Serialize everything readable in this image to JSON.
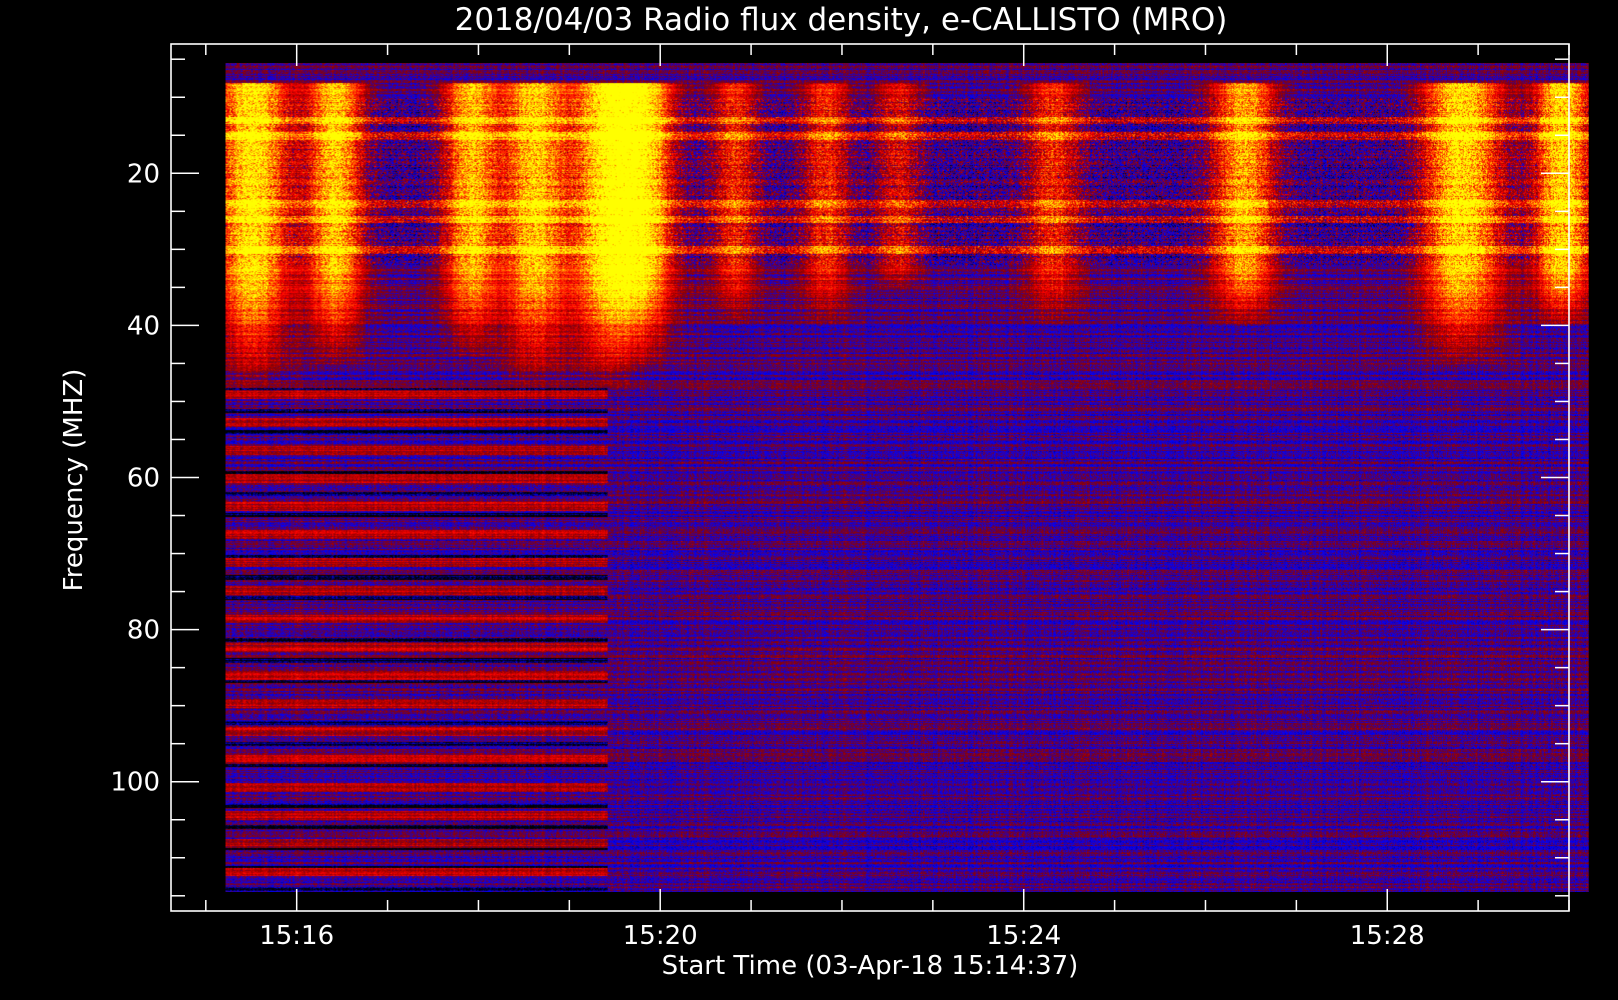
{
  "chart_data": {
    "type": "heatmap",
    "title": "2018/04/03  Radio flux density, e-CALLISTO (MRO)",
    "xlabel": "Start Time (03-Apr-18 15:14:37)",
    "ylabel": "Frequency (MHZ)",
    "x_range": [
      "15:14:37",
      "15:30:00"
    ],
    "y_range_mhz": [
      117,
      3
    ],
    "y_axis_inverted": true,
    "x_tick_labels": [
      "15:16",
      "15:20",
      "15:24",
      "15:28"
    ],
    "x_tick_values_min": [
      1.383,
      5.383,
      9.383,
      13.383
    ],
    "y_tick_labels": [
      "20",
      "40",
      "60",
      "80",
      "100"
    ],
    "y_tick_values": [
      20,
      40,
      60,
      80,
      100
    ],
    "data_time_range_min": [
      0.6,
      15.6
    ],
    "data_freq_range_mhz": [
      5.5,
      114.5
    ],
    "colormap": [
      "#000000",
      "#0000ff",
      "#8b0000",
      "#ff0000",
      "#ff8000",
      "#ffff00"
    ],
    "background_level": 0.3,
    "intensity": {
      "description": "vertical broadband bursts at start times in minutes (relative to 15:14:37), strong emission between 8 and 45 MHz; quiet band-structured region below 48 MHz before 15:18:40",
      "bursts_min": [
        {
          "t": 0.9,
          "width": 0.45,
          "strength": 0.95,
          "f_low": 8,
          "f_high": 48
        },
        {
          "t": 1.8,
          "width": 0.35,
          "strength": 0.85,
          "f_low": 8,
          "f_high": 45
        },
        {
          "t": 3.3,
          "width": 0.35,
          "strength": 0.8,
          "f_low": 8,
          "f_high": 44
        },
        {
          "t": 4.0,
          "width": 0.4,
          "strength": 0.85,
          "f_low": 8,
          "f_high": 48
        },
        {
          "t": 4.8,
          "width": 0.45,
          "strength": 0.95,
          "f_low": 8,
          "f_high": 48
        },
        {
          "t": 5.2,
          "width": 0.4,
          "strength": 0.8,
          "f_low": 8,
          "f_high": 45
        },
        {
          "t": 6.2,
          "width": 0.3,
          "strength": 0.45,
          "f_low": 8,
          "f_high": 40
        },
        {
          "t": 7.2,
          "width": 0.3,
          "strength": 0.45,
          "f_low": 8,
          "f_high": 40
        },
        {
          "t": 8.0,
          "width": 0.3,
          "strength": 0.35,
          "f_low": 8,
          "f_high": 35
        },
        {
          "t": 9.7,
          "width": 0.35,
          "strength": 0.45,
          "f_low": 8,
          "f_high": 40
        },
        {
          "t": 11.8,
          "width": 0.4,
          "strength": 0.75,
          "f_low": 8,
          "f_high": 40
        },
        {
          "t": 14.2,
          "width": 0.5,
          "strength": 0.9,
          "f_low": 8,
          "f_high": 45
        },
        {
          "t": 15.3,
          "width": 0.35,
          "strength": 0.9,
          "f_low": 8,
          "f_high": 40
        }
      ],
      "bright_lines_mhz": [
        13,
        15,
        24,
        26,
        30
      ]
    }
  }
}
